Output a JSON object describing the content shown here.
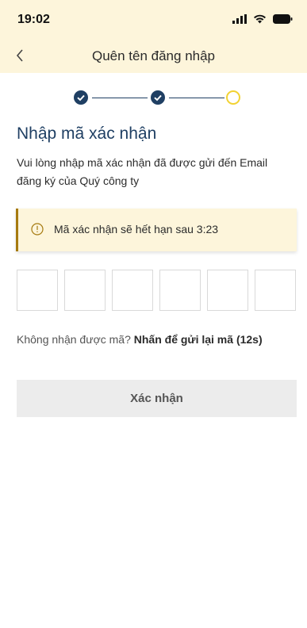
{
  "status_bar": {
    "time": "19:02"
  },
  "nav": {
    "title": "Quên tên đăng nhập"
  },
  "stepper": {
    "steps_completed": 2,
    "total_steps": 3
  },
  "main": {
    "heading": "Nhập mã xác nhận",
    "description": "Vui lòng nhập mã xác nhận đã được gửi đến Email đăng ký của Quý công ty",
    "alert": {
      "text": "Mã xác nhận sẽ hết hạn sau 3:23",
      "icon": "info-circle-icon"
    },
    "otp": {
      "length": 6,
      "values": [
        "",
        "",
        "",
        "",
        "",
        ""
      ]
    },
    "resend": {
      "prompt": "Không nhận được mã?",
      "action": "Nhấn để gửi lại mã",
      "countdown": "(12s)"
    },
    "confirm_label": "Xác nhận"
  },
  "colors": {
    "header_bg": "#fdf5db",
    "primary": "#1f3f63",
    "step_current": "#f2d232",
    "alert_border": "#a67a0f",
    "button_disabled": "#ececec"
  }
}
